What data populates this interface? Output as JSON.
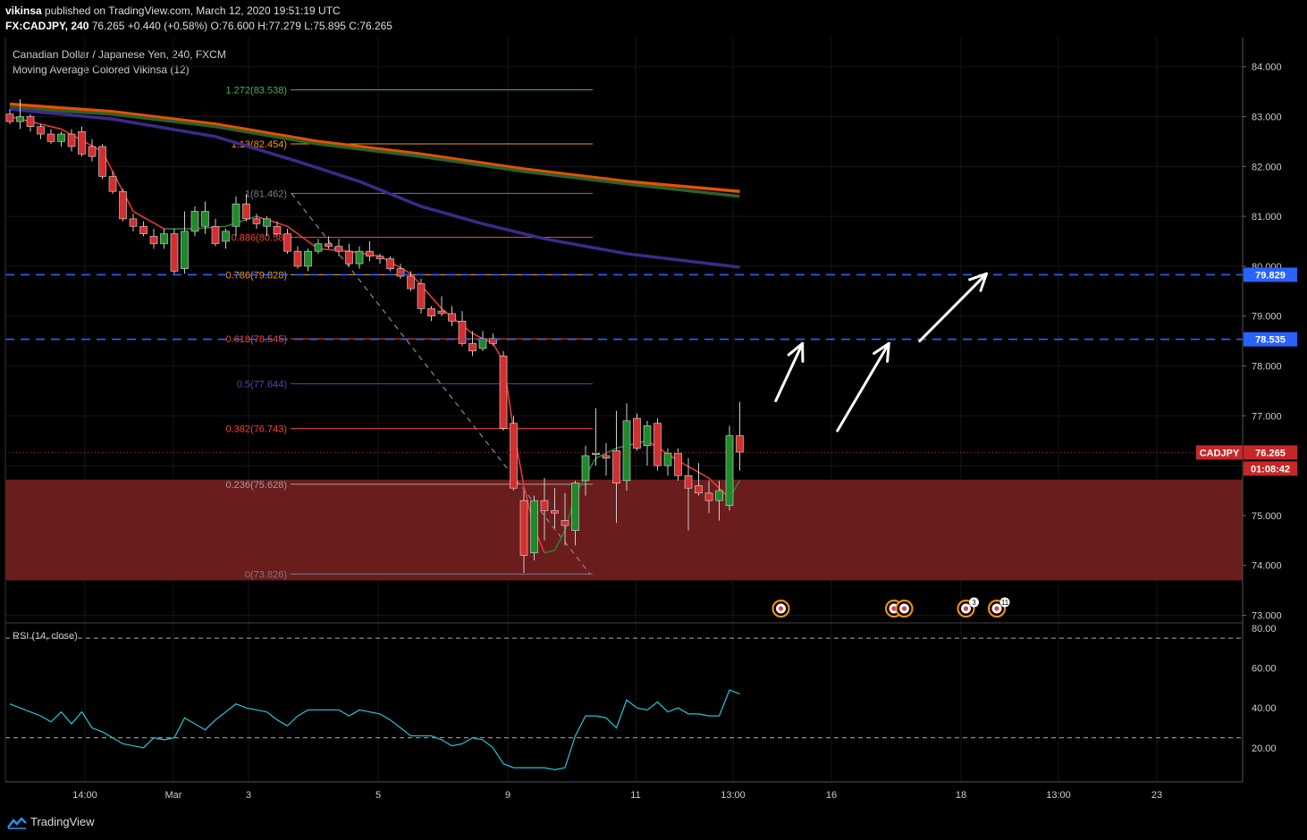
{
  "header": {
    "publisher": "vikinsa",
    "published_line": "published on TradingView.com, March 12, 2020 19:51:19 UTC",
    "symbol_line": "FX:CADJPY, 240",
    "price_line": "76.265 +0.440 (+0.58%) O:76.600 H:77.279 L:75.895 C:76.265"
  },
  "legend": {
    "instrument": "Canadian Dollar / Japanese Yen, 240, FXCM",
    "indicator": "Moving Average Colored Vikinsa (12)",
    "rsi": "RSI (14, close)"
  },
  "branding": {
    "footer": "TradingView"
  },
  "colors": {
    "background": "#000000",
    "bull": "#1f8a2a",
    "bear": "#d32f2f",
    "support_zone": "#6b1c1c",
    "level_line": "#2962ff",
    "ma_fast": "#e65100",
    "ma_mid": "#2e5f2e",
    "ma_slow": "#3c2a8a",
    "rsi": "#26c6da"
  },
  "chart_data": {
    "type": "candlestick",
    "price_axis": {
      "ticks": [
        "84.000",
        "83.000",
        "82.000",
        "81.000",
        "80.000",
        "79.000",
        "78.000",
        "77.000",
        "76.000",
        "75.000",
        "74.000",
        "73.000"
      ],
      "range": [
        73.0,
        84.0
      ]
    },
    "time_axis": {
      "ticks": [
        "14:00",
        "Mar",
        "3",
        "5",
        "9",
        "11",
        "13:00",
        "16",
        "18",
        "13:00",
        "23"
      ]
    },
    "price_labels": [
      {
        "text": "79.829",
        "value": 79.829,
        "color": "#2962ff"
      },
      {
        "text": "78.535",
        "value": 78.535,
        "color": "#2962ff"
      },
      {
        "text": "CADJPY",
        "value": 76.265,
        "color": "#c62828"
      },
      {
        "text": "76.265",
        "value": 76.265,
        "color": "#c62828"
      },
      {
        "text": "01:08:42",
        "value": 76.265,
        "color": "#c62828"
      }
    ],
    "horizontal_levels": [
      79.829,
      78.535
    ],
    "support_zone": [
      73.7,
      75.72
    ],
    "last_price": 76.265,
    "fib_levels": [
      {
        "label": "1.272(83.538)",
        "value": 83.538,
        "color": "#4caf50"
      },
      {
        "label": "1.13(82.454)",
        "value": 82.454,
        "color": "#ff9800"
      },
      {
        "label": "1(81.462)",
        "value": 81.462,
        "color": "#787b86"
      },
      {
        "label": "0.886(80.58)",
        "value": 80.58,
        "color": "#f44336"
      },
      {
        "label": "0.786(79.828)",
        "value": 79.828,
        "color": "#ff9800"
      },
      {
        "label": "0.618(78.545)",
        "value": 78.545,
        "color": "#f44336"
      },
      {
        "label": "0.5(77.644)",
        "value": 77.644,
        "color": "#673ab7"
      },
      {
        "label": "0.382(76.743)",
        "value": 76.743,
        "color": "#f44336"
      },
      {
        "label": "0.236(75.628)",
        "value": 75.628,
        "color": "#9e9e9e"
      },
      {
        "label": "0(73.826)",
        "value": 73.826,
        "color": "#787b86"
      }
    ],
    "candles": [
      [
        83.05,
        83.15,
        82.85,
        82.9
      ],
      [
        82.9,
        83.35,
        82.75,
        83.0
      ],
      [
        83.0,
        83.05,
        82.7,
        82.8
      ],
      [
        82.8,
        82.85,
        82.55,
        82.65
      ],
      [
        82.65,
        82.75,
        82.45,
        82.5
      ],
      [
        82.5,
        82.7,
        82.4,
        82.65
      ],
      [
        82.65,
        82.75,
        82.3,
        82.4
      ],
      [
        82.7,
        82.8,
        82.2,
        82.25
      ],
      [
        82.4,
        82.55,
        82.1,
        82.2
      ],
      [
        82.4,
        82.45,
        81.75,
        81.8
      ],
      [
        81.8,
        81.9,
        81.45,
        81.5
      ],
      [
        81.5,
        81.55,
        80.9,
        80.95
      ],
      [
        80.95,
        81.05,
        80.7,
        80.8
      ],
      [
        80.8,
        80.9,
        80.6,
        80.65
      ],
      [
        80.6,
        80.75,
        80.35,
        80.45
      ],
      [
        80.45,
        80.75,
        80.35,
        80.65
      ],
      [
        80.65,
        80.75,
        79.85,
        79.9
      ],
      [
        79.95,
        81.1,
        79.85,
        80.7
      ],
      [
        80.7,
        81.2,
        80.6,
        81.1
      ],
      [
        80.8,
        81.3,
        80.65,
        81.1
      ],
      [
        80.8,
        80.95,
        80.4,
        80.45
      ],
      [
        80.5,
        80.75,
        80.35,
        80.7
      ],
      [
        80.8,
        81.4,
        80.6,
        81.25
      ],
      [
        81.25,
        81.45,
        80.9,
        80.95
      ],
      [
        80.95,
        81.05,
        80.75,
        80.85
      ],
      [
        80.8,
        81.0,
        80.6,
        80.95
      ],
      [
        80.8,
        80.9,
        80.6,
        80.65
      ],
      [
        80.65,
        80.75,
        80.25,
        80.3
      ],
      [
        80.3,
        80.4,
        79.95,
        80.0
      ],
      [
        80.0,
        80.35,
        79.9,
        80.3
      ],
      [
        80.3,
        80.55,
        80.25,
        80.45
      ],
      [
        80.45,
        80.6,
        80.35,
        80.4
      ],
      [
        80.4,
        80.55,
        80.2,
        80.3
      ],
      [
        80.3,
        80.45,
        80.0,
        80.05
      ],
      [
        80.05,
        80.4,
        79.95,
        80.3
      ],
      [
        80.3,
        80.5,
        80.1,
        80.2
      ],
      [
        80.2,
        80.25,
        80.05,
        80.15
      ],
      [
        80.15,
        80.2,
        79.9,
        79.95
      ],
      [
        79.95,
        80.05,
        79.75,
        79.8
      ],
      [
        79.8,
        79.9,
        79.5,
        79.55
      ],
      [
        79.65,
        79.75,
        79.05,
        79.15
      ],
      [
        79.15,
        79.2,
        78.9,
        79.0
      ],
      [
        79.1,
        79.4,
        79.0,
        79.05
      ],
      [
        79.05,
        79.2,
        78.8,
        78.9
      ],
      [
        78.9,
        79.1,
        78.4,
        78.45
      ],
      [
        78.45,
        78.7,
        78.2,
        78.3
      ],
      [
        78.35,
        78.7,
        78.3,
        78.55
      ],
      [
        78.55,
        78.65,
        78.4,
        78.45
      ],
      [
        78.2,
        78.3,
        76.7,
        76.75
      ],
      [
        76.85,
        77.0,
        75.5,
        75.55
      ],
      [
        75.3,
        75.5,
        73.85,
        74.2
      ],
      [
        74.25,
        75.4,
        74.1,
        75.3
      ],
      [
        75.3,
        75.75,
        74.5,
        75.1
      ],
      [
        75.1,
        75.55,
        74.75,
        75.05
      ],
      [
        74.9,
        75.45,
        74.4,
        74.8
      ],
      [
        74.7,
        75.7,
        74.4,
        75.65
      ],
      [
        75.7,
        76.4,
        75.4,
        76.2
      ],
      [
        76.25,
        77.15,
        76.0,
        76.25
      ],
      [
        76.2,
        76.45,
        75.8,
        76.15
      ],
      [
        76.3,
        77.1,
        74.85,
        75.65
      ],
      [
        75.7,
        77.25,
        75.5,
        76.9
      ],
      [
        76.95,
        77.05,
        76.3,
        76.35
      ],
      [
        76.4,
        76.9,
        76.0,
        76.8
      ],
      [
        76.85,
        76.95,
        75.9,
        76.0
      ],
      [
        76.0,
        76.35,
        75.8,
        76.25
      ],
      [
        76.25,
        76.35,
        75.7,
        75.8
      ],
      [
        75.8,
        76.15,
        74.7,
        75.55
      ],
      [
        75.6,
        76.05,
        75.4,
        75.45
      ],
      [
        75.45,
        75.7,
        75.05,
        75.3
      ],
      [
        75.3,
        75.7,
        74.9,
        75.5
      ],
      [
        75.2,
        76.8,
        75.1,
        76.6
      ],
      [
        76.6,
        77.28,
        75.9,
        76.27
      ]
    ],
    "ma_colored": [
      [
        0,
        83.0
      ],
      [
        5,
        82.75
      ],
      [
        9,
        82.3
      ],
      [
        12,
        81.1
      ],
      [
        15,
        80.75
      ],
      [
        18,
        80.75
      ],
      [
        21,
        80.8
      ],
      [
        24,
        81.0
      ],
      [
        27,
        80.8
      ],
      [
        30,
        80.35
      ],
      [
        33,
        80.3
      ],
      [
        36,
        80.2
      ],
      [
        39,
        79.85
      ],
      [
        42,
        79.15
      ],
      [
        45,
        78.65
      ],
      [
        47,
        78.45
      ],
      [
        48,
        78.1
      ],
      [
        49,
        76.7
      ],
      [
        50,
        75.6
      ],
      [
        51,
        74.75
      ],
      [
        52,
        74.25
      ],
      [
        53,
        74.3
      ],
      [
        54,
        74.7
      ],
      [
        55,
        75.4
      ],
      [
        56,
        75.8
      ],
      [
        57,
        76.15
      ],
      [
        59,
        76.35
      ],
      [
        62,
        76.5
      ],
      [
        65,
        76.1
      ],
      [
        68,
        75.75
      ],
      [
        69,
        75.55
      ],
      [
        70,
        75.35
      ],
      [
        71,
        75.7
      ]
    ],
    "moving_averages": [
      {
        "color": "#e65100",
        "points": [
          [
            0,
            83.25
          ],
          [
            10,
            83.1
          ],
          [
            20,
            82.85
          ],
          [
            30,
            82.5
          ],
          [
            40,
            82.25
          ],
          [
            50,
            81.95
          ],
          [
            60,
            81.7
          ],
          [
            71,
            81.5
          ]
        ]
      },
      {
        "color": "#2e5f2e",
        "points": [
          [
            0,
            83.18
          ],
          [
            10,
            83.05
          ],
          [
            20,
            82.8
          ],
          [
            30,
            82.45
          ],
          [
            40,
            82.2
          ],
          [
            50,
            81.9
          ],
          [
            60,
            81.65
          ],
          [
            71,
            81.4
          ]
        ]
      },
      {
        "color": "#3c2a8a",
        "points": [
          [
            0,
            83.15
          ],
          [
            10,
            82.95
          ],
          [
            20,
            82.6
          ],
          [
            28,
            82.1
          ],
          [
            34,
            81.7
          ],
          [
            40,
            81.2
          ],
          [
            46,
            80.85
          ],
          [
            52,
            80.55
          ],
          [
            60,
            80.25
          ],
          [
            71,
            79.98
          ]
        ]
      }
    ],
    "rsi": {
      "ticks": [
        "80.00",
        "60.00",
        "40.00",
        "20.00"
      ],
      "bands": [
        75,
        25
      ],
      "values": [
        42,
        40,
        38,
        36,
        33,
        38,
        32,
        38,
        30,
        28,
        25,
        22,
        21,
        20,
        25,
        24,
        25,
        35,
        32,
        29,
        34,
        38,
        42,
        40,
        39,
        38,
        34,
        31,
        36,
        39,
        39,
        39,
        39,
        36,
        39,
        38,
        37,
        34,
        30,
        26,
        26,
        26,
        24,
        21,
        22,
        25,
        24,
        20,
        12,
        10,
        10,
        10,
        10,
        9,
        10,
        26,
        36,
        36,
        35,
        30,
        44,
        40,
        39,
        43,
        38,
        40,
        37,
        37,
        36,
        36,
        49,
        47
      ]
    },
    "events": [
      {
        "index": 75,
        "count": ""
      },
      {
        "index": 86,
        "count": ""
      },
      {
        "index": 87,
        "count": ""
      },
      {
        "index": 93,
        "count": "3"
      },
      {
        "index": 96,
        "count": "11"
      }
    ],
    "arrows": [
      {
        "from": [
          74.5,
          77.3
        ],
        "to": [
          77.1,
          78.45
        ]
      },
      {
        "from": [
          80.5,
          76.7
        ],
        "to": [
          85.5,
          78.45
        ]
      },
      {
        "from": [
          88.5,
          78.5
        ],
        "to": [
          95.0,
          79.85
        ]
      }
    ]
  }
}
